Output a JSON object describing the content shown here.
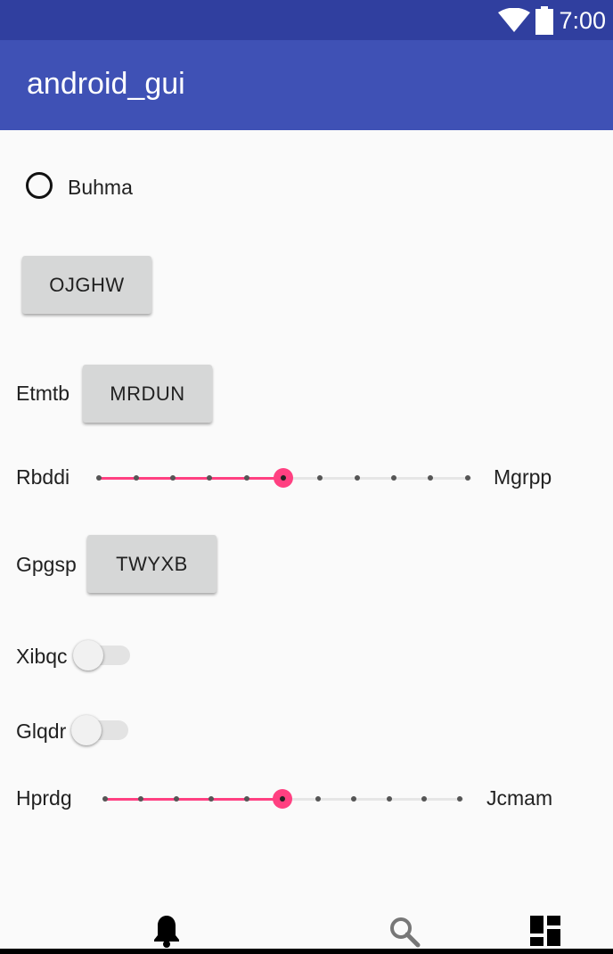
{
  "status": {
    "time": "7:00"
  },
  "app": {
    "title": "android_gui"
  },
  "radio": {
    "label": "Buhma",
    "checked": false
  },
  "buttons": {
    "b1": "OJGHW",
    "b2": "MRDUN",
    "b3": "TWYXB"
  },
  "rows": {
    "etmtb": "Etmtb",
    "rbddi": "Rbddi",
    "mgrpp": "Mgrpp",
    "gpgsp": "Gpgsp",
    "xibqc": "Xibqc",
    "glqdr": "Glqdr",
    "hprdg": "Hprdg",
    "jcmam": "Jcmam"
  },
  "slider1": {
    "value_index": 5,
    "steps": 10
  },
  "slider2": {
    "value_index": 5,
    "steps": 10
  },
  "switches": {
    "xibqc": false,
    "glqdr": false
  },
  "bottom_nav": [
    "notifications-icon",
    "search-icon",
    "dashboard-icon"
  ],
  "colors": {
    "primary": "#3f51b5",
    "primary_dark": "#303f9f",
    "accent": "#ff4081"
  }
}
